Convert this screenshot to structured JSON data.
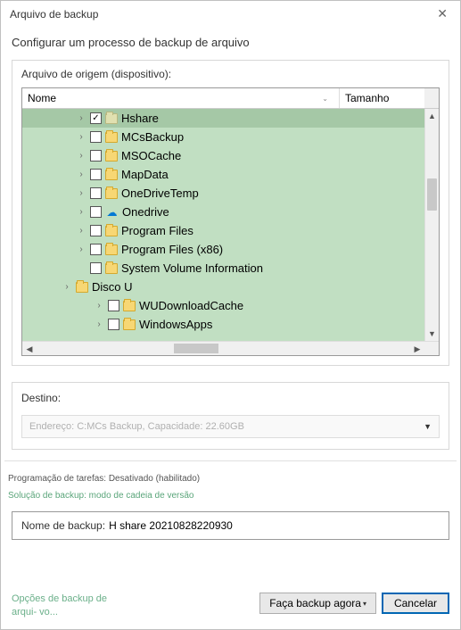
{
  "window": {
    "title": "Arquivo de backup",
    "subtitle": "Configurar um processo de backup de arquivo"
  },
  "source": {
    "group_label": "Arquivo de origem (dispositivo):",
    "col_name": "Nome",
    "col_size": "Tamanho",
    "items": [
      {
        "label": "Hshare",
        "checked": true,
        "selected": true,
        "indent": 0,
        "icon": "folder-dim",
        "expandable": true
      },
      {
        "label": "MCsBackup",
        "checked": false,
        "selected": false,
        "indent": 0,
        "icon": "folder",
        "expandable": true
      },
      {
        "label": "MSOCache",
        "checked": false,
        "selected": false,
        "indent": 0,
        "icon": "folder",
        "expandable": true
      },
      {
        "label": "MapData",
        "checked": false,
        "selected": false,
        "indent": 0,
        "icon": "folder",
        "expandable": true
      },
      {
        "label": "OneDriveTemp",
        "checked": false,
        "selected": false,
        "indent": 0,
        "icon": "folder",
        "expandable": true
      },
      {
        "label": "Onedrive",
        "checked": false,
        "selected": false,
        "indent": 0,
        "icon": "cloud",
        "expandable": true
      },
      {
        "label": "Program Files",
        "checked": false,
        "selected": false,
        "indent": 0,
        "icon": "folder",
        "expandable": true
      },
      {
        "label": "Program Files (x86)",
        "checked": false,
        "selected": false,
        "indent": 0,
        "icon": "folder",
        "expandable": true
      },
      {
        "label": "System Volume Information",
        "checked": false,
        "selected": false,
        "indent": 0,
        "icon": "folder",
        "expandable": false
      },
      {
        "label": "Disco U",
        "checked": false,
        "selected": false,
        "indent": 0,
        "icon": "folder",
        "expandable": true,
        "noCheckboxIndent": true
      },
      {
        "label": "WUDownloadCache",
        "checked": false,
        "selected": false,
        "indent": 1,
        "icon": "folder",
        "expandable": true
      },
      {
        "label": "WindowsApps",
        "checked": false,
        "selected": false,
        "indent": 1,
        "icon": "folder",
        "expandable": true
      }
    ]
  },
  "destination": {
    "group_label": "Destino:",
    "combo_text": "Endereço: C:MCs Backup, Capacidade: 22.60GB"
  },
  "schedule": {
    "text": "Programação de tarefas: Desativado (habilitado)"
  },
  "solution": {
    "text": "Solução de backup: modo de cadeia de versão"
  },
  "backup_name": {
    "label": "Nome de backup:",
    "value": "H share 20210828220930"
  },
  "footer": {
    "options_link": "Opções de backup de arqui-\nvo...",
    "backup_now": "Faça backup agora",
    "cancel": "Cancelar"
  }
}
